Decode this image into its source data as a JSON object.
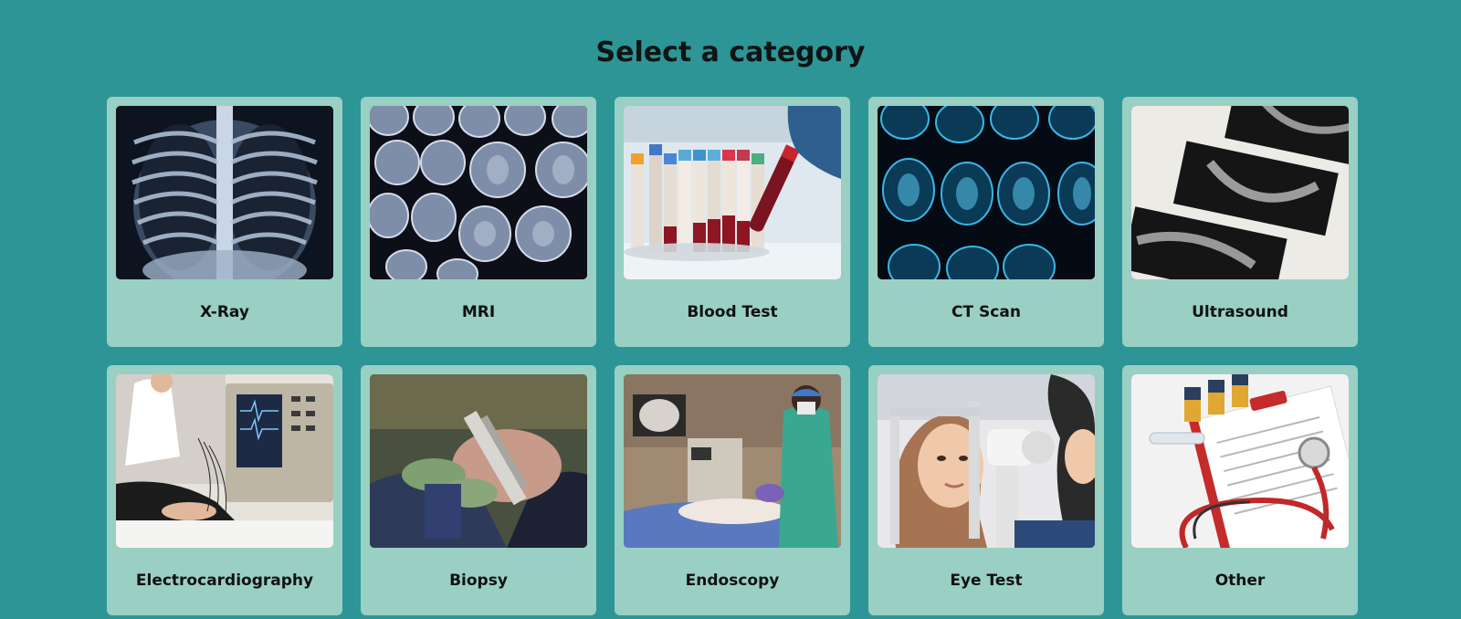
{
  "header": {
    "title": "Select a category"
  },
  "categories": [
    {
      "label": "X-Ray",
      "icon": "xray-chest-image"
    },
    {
      "label": "MRI",
      "icon": "mri-brain-scans-image"
    },
    {
      "label": "Blood Test",
      "icon": "blood-test-tubes-image"
    },
    {
      "label": "CT Scan",
      "icon": "ct-brain-scans-image"
    },
    {
      "label": "Ultrasound",
      "icon": "ultrasound-prints-image"
    },
    {
      "label": "Electrocardiography",
      "icon": "ecg-machine-image"
    },
    {
      "label": "Biopsy",
      "icon": "biopsy-procedure-image"
    },
    {
      "label": "Endoscopy",
      "icon": "endoscopy-room-image"
    },
    {
      "label": "Eye Test",
      "icon": "eye-exam-image"
    },
    {
      "label": "Other",
      "icon": "stethoscope-clipboard-image"
    }
  ],
  "colors": {
    "background": "#2d9596",
    "card": "#99d0c3",
    "text": "#111111"
  }
}
